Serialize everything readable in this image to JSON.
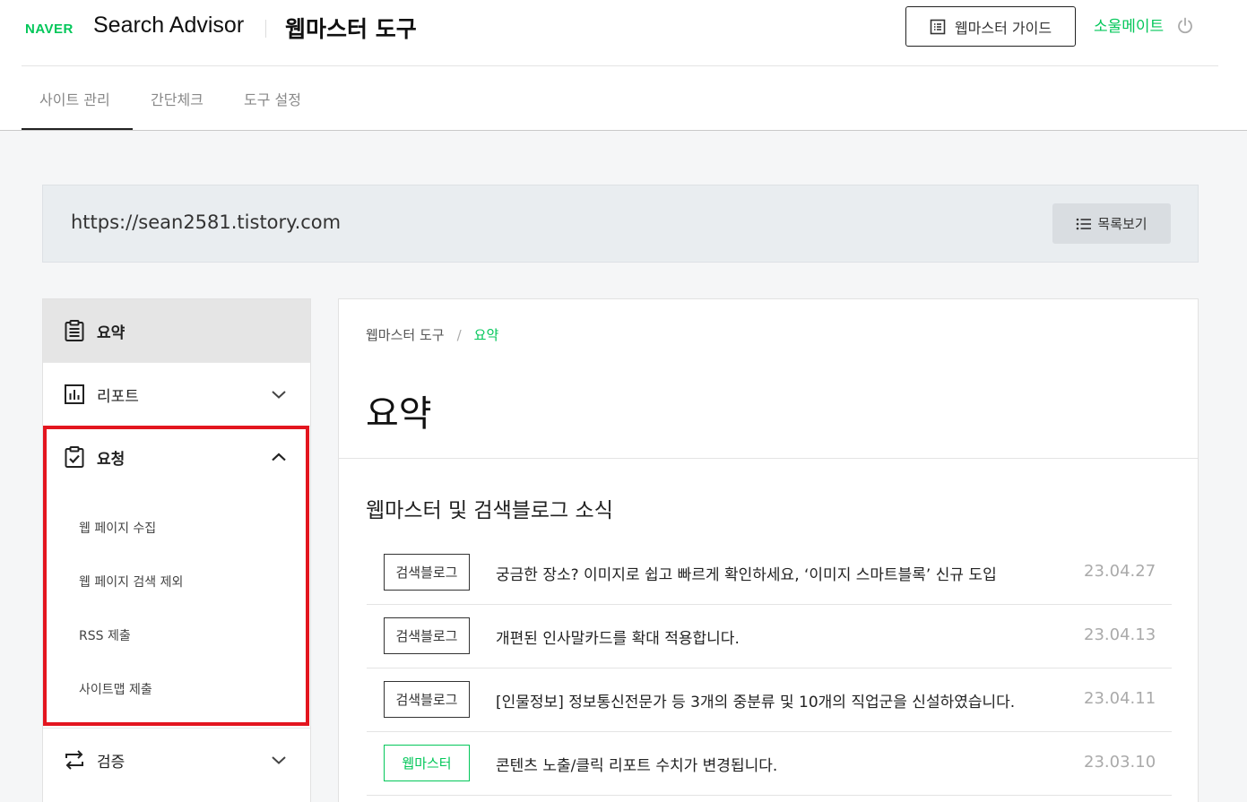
{
  "header": {
    "brand": "NAVER",
    "product": "Search Advisor",
    "tool_title": "웹마스터 도구",
    "guide_button": "웹마스터 가이드",
    "user_name": "소울메이트",
    "tabs": [
      {
        "label": "사이트 관리",
        "active": true
      },
      {
        "label": "간단체크",
        "active": false
      },
      {
        "label": "도구 설정",
        "active": false
      }
    ]
  },
  "site": {
    "url": "https://sean2581.tistory.com",
    "list_button": "목록보기"
  },
  "sidebar": {
    "items": [
      {
        "label": "요약",
        "icon": "clipboard-list-icon",
        "selected": true
      },
      {
        "label": "리포트",
        "icon": "bar-chart-icon",
        "expanded": false
      },
      {
        "label": "요청",
        "icon": "clipboard-check-icon",
        "expanded": true
      },
      {
        "label": "검증",
        "icon": "swap-arrows-icon",
        "expanded": false
      }
    ],
    "request_subitems": [
      "웹 페이지 수집",
      "웹 페이지 검색 제외",
      "RSS 제출",
      "사이트맵 제출"
    ]
  },
  "main": {
    "breadcrumb": {
      "root": "웹마스터 도구",
      "separator": "/",
      "current": "요약"
    },
    "title": "요약",
    "news_section_title": "웹마스터 및 검색블로그 소식",
    "news": [
      {
        "tag": "검색블로그",
        "title": "궁금한 장소? 이미지로 쉽고 빠르게 확인하세요, ‘이미지 스마트블록’ 신규 도입",
        "date": "23.04.27"
      },
      {
        "tag": "검색블로그",
        "title": "개편된 인사말카드를 확대 적용합니다.",
        "date": "23.04.13"
      },
      {
        "tag": "검색블로그",
        "title": "[인물정보] 정보통신전문가 등 3개의 중분류 및 10개의 직업군을 신설하였습니다.",
        "date": "23.04.11"
      },
      {
        "tag": "웹마스터",
        "title": "콘텐츠 노출/클릭 리포트 수치가 변경됩니다.",
        "date": "23.03.10"
      }
    ]
  },
  "colors": {
    "brand_green": "#03c75a",
    "highlight_red": "#e3151f"
  }
}
